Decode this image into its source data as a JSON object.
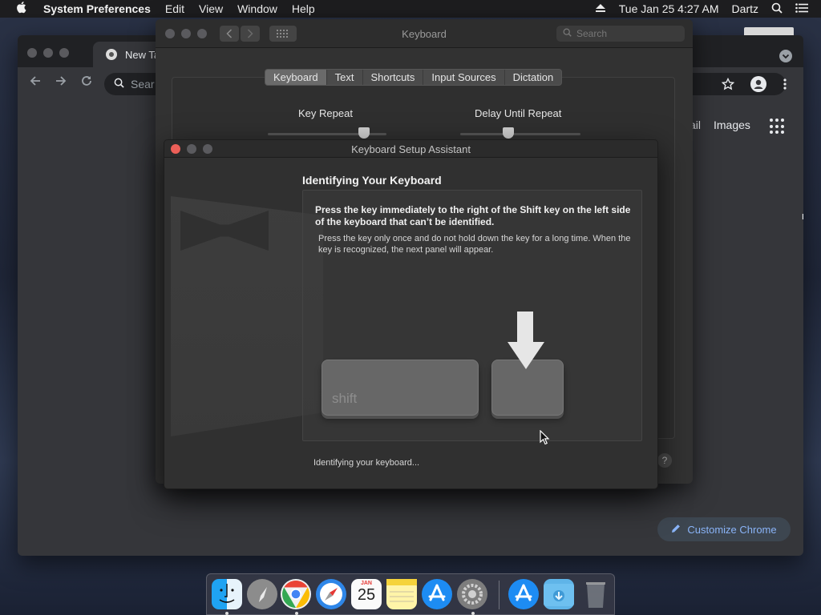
{
  "menubar": {
    "apple": "",
    "app_name": "System Preferences",
    "items": [
      "Edit",
      "View",
      "Window",
      "Help"
    ],
    "datetime": "Tue Jan 25  4:27 AM",
    "user": "Dartz"
  },
  "chrome": {
    "tab_title": "New Tab",
    "omnibox_text": "Sear",
    "gmail_fragment": "ail",
    "images_link": "Images",
    "customize_label": "Customize Chrome",
    "edge_fragment": "m"
  },
  "sysprefs": {
    "title": "Keyboard",
    "search_placeholder": "Search",
    "tabs": [
      "Keyboard",
      "Text",
      "Shortcuts",
      "Input Sources",
      "Dictation"
    ],
    "key_repeat_label": "Key Repeat",
    "delay_label": "Delay Until Repeat",
    "help_label": "?"
  },
  "assistant": {
    "title": "Keyboard Setup Assistant",
    "heading": "Identifying Your Keyboard",
    "instruction": "Press the key immediately to the right of the Shift key on the left side of the keyboard that can’t be identified.",
    "sub_instruction": "Press the key only once and do not hold down the key for a long time. When the key is recognized, the next panel will appear.",
    "shift_label": "shift",
    "status": "Identifying your keyboard..."
  },
  "dock": {
    "calendar_month": "JAN",
    "calendar_day": "25"
  },
  "colors": {
    "close_red": "#ec5f58",
    "chrome_accent": "#8ab4f8"
  }
}
